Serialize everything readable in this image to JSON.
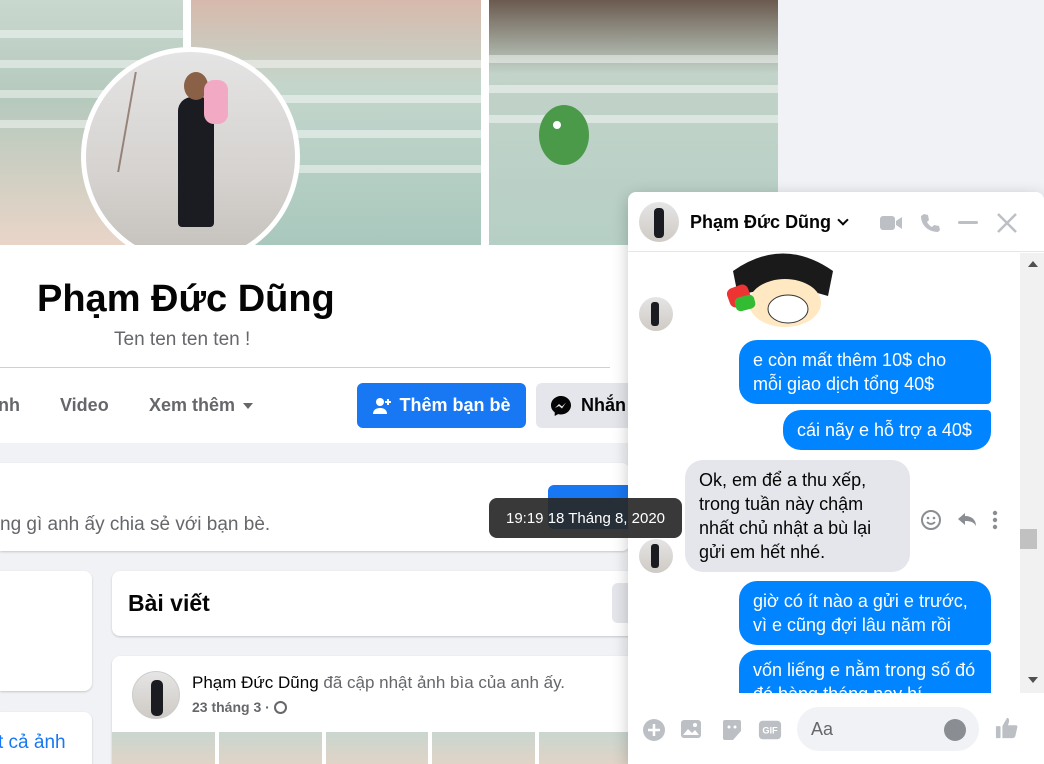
{
  "profile": {
    "name": "Phạm Đức Dũng",
    "bio": "Ten ten ten ten !"
  },
  "nav": {
    "partial_item": "nh",
    "video": "Video",
    "more": "Xem thêm"
  },
  "actions": {
    "add_friend": "Thêm bạn bè",
    "message": "Nhắn"
  },
  "share_card": {
    "text": "ng gì anh ấy chia sẻ với bạn bè."
  },
  "left_links": {
    "see_all_photos": "t cả ảnh"
  },
  "posts": {
    "title": "Bài viết",
    "author": "Phạm Đức Dũng",
    "activity": " đã cập nhật ảnh bìa của anh ấy.",
    "date": "23 tháng 3 ·"
  },
  "tooltip": {
    "text": "19:19 18 Tháng 8, 2020"
  },
  "chat": {
    "contact_name": "Phạm Đức Dũng",
    "messages": [
      {
        "from": "me",
        "text": "e còn mất thêm 10$ cho mỗi giao dịch tổng 40$"
      },
      {
        "from": "me",
        "text": "cái nãy e hỗ trợ a 40$"
      },
      {
        "from": "them",
        "text": "Ok, em để a thu xếp, trong tuần này chậm nhất chủ nhật a bù lại gửi em hết nhé."
      },
      {
        "from": "me",
        "text": "giờ có ít nào a gửi e trước, vì e cũng đợi lâu năm rồi"
      },
      {
        "from": "me",
        "text": "vốn liếng e nằm trong số đó đó hàng tháng nay hí"
      }
    ],
    "input_placeholder": "Aa",
    "gif_label": "GIF"
  },
  "colors": {
    "brand": "#1877f2",
    "messenger_out": "#0084ff",
    "bubble_in": "#e4e6eb",
    "text_secondary": "#65676b"
  },
  "icons": [
    "add-friend-icon",
    "messenger-icon",
    "video-call-icon",
    "phone-icon",
    "minimize-icon",
    "close-icon",
    "plus-circle-icon",
    "image-icon",
    "sticker-icon",
    "gif-icon",
    "emoji-icon",
    "like-icon",
    "reply-icon",
    "more-icon",
    "globe-icon"
  ]
}
